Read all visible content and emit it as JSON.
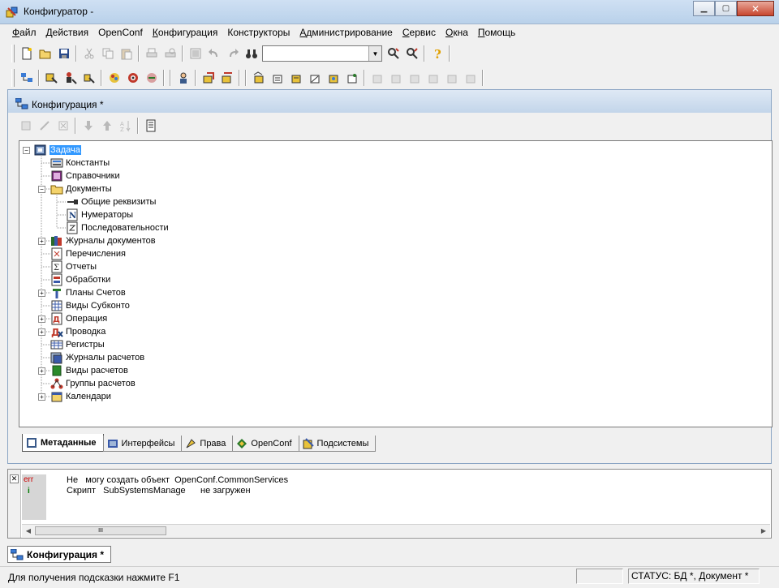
{
  "window": {
    "title": "Конфигуратор -"
  },
  "menu": [
    {
      "label": "Файл",
      "ul": "Ф",
      "rest": "айл"
    },
    {
      "label": "Действия",
      "ul": "Д",
      "rest": "ействия"
    },
    {
      "label": "OpenConf",
      "ul": "",
      "rest": "OpenConf"
    },
    {
      "label": "Конфигурация",
      "ul": "К",
      "rest": "онфигурация"
    },
    {
      "label": "Конструкторы",
      "ul": "",
      "rest": "Конструкторы"
    },
    {
      "label": "Администрирование",
      "ul": "А",
      "rest": "дминистрирование"
    },
    {
      "label": "Сервис",
      "ul": "С",
      "rest": "ервис"
    },
    {
      "label": "Окна",
      "ul": "О",
      "rest": "кна"
    },
    {
      "label": "Помощь",
      "ul": "П",
      "rest": "омощь"
    }
  ],
  "search": {
    "value": ""
  },
  "child": {
    "title": "Конфигурация *"
  },
  "tree": {
    "root": "Задача",
    "items": [
      {
        "label": "Константы"
      },
      {
        "label": "Справочники"
      },
      {
        "label": "Документы"
      },
      {
        "label": "Общие реквизиты"
      },
      {
        "label": "Нумераторы"
      },
      {
        "label": "Последовательности"
      },
      {
        "label": "Журналы документов"
      },
      {
        "label": "Перечисления"
      },
      {
        "label": "Отчеты"
      },
      {
        "label": "Обработки"
      },
      {
        "label": "Планы Счетов"
      },
      {
        "label": "Виды Субконто"
      },
      {
        "label": "Операция"
      },
      {
        "label": "Проводка"
      },
      {
        "label": "Регистры"
      },
      {
        "label": "Журналы расчетов"
      },
      {
        "label": "Виды расчетов"
      },
      {
        "label": "Группы расчетов"
      },
      {
        "label": "Календари"
      }
    ]
  },
  "tabs": [
    {
      "label": "Метаданные",
      "icon": "metadata-icon",
      "active": true
    },
    {
      "label": "Интерфейсы",
      "icon": "interfaces-icon",
      "active": false
    },
    {
      "label": "Права",
      "icon": "rights-icon",
      "active": false
    },
    {
      "label": "OpenConf",
      "icon": "openconf-icon",
      "active": false
    },
    {
      "label": "Подсистемы",
      "icon": "subsystems-icon",
      "active": false
    }
  ],
  "messages": [
    {
      "type": "err",
      "text": "Не   могу создать объект  OpenConf.CommonServices"
    },
    {
      "type": "i",
      "text": "Скрипт   SubSystemsManage      не загружен"
    }
  ],
  "scroll": {
    "thumb": "III"
  },
  "window_list": {
    "label": "Конфигурация *"
  },
  "status": {
    "hint": "Для получения подсказки нажмите F1",
    "state": "СТАТУС: БД *, Документ *"
  },
  "colors": {
    "selection": "#3399ff",
    "err": "#cc0000",
    "info": "#007a00"
  }
}
